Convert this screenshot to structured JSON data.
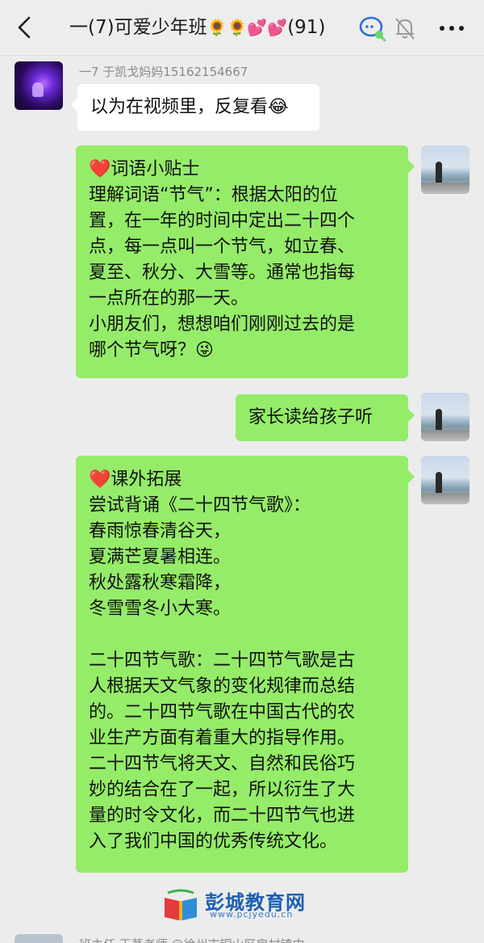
{
  "header": {
    "title_prefix": "一(7)可爱少年班",
    "title_emojis": "🌻🌻💕💕",
    "member_count": "(91)",
    "back_icon": "chevron-left-icon",
    "mention_icon": "chat-search-icon",
    "mute_icon": "bell-off-icon",
    "more_icon": "more-dots-icon"
  },
  "messages": [
    {
      "side": "left",
      "sender": "一7  于凯戈妈妈15162154667",
      "lines": [
        "以为在视频里，反复看😂"
      ]
    },
    {
      "side": "right",
      "lines": [
        "❤️词语小贴士",
        "理解词语“节气”：根据太阳的位",
        "置，在一年的时间中定出二十四个",
        "点，每一点叫一个节气，如立春、",
        "夏至、秋分、大雪等。通常也指每",
        "一点所在的那一天。",
        "小朋友们，想想咱们刚刚过去的是",
        "哪个节气呀？😜"
      ]
    },
    {
      "side": "right",
      "lines": [
        "家长读给孩子听"
      ]
    },
    {
      "side": "right",
      "lines": [
        "❤️课外拓展",
        "尝试背诵《二十四节气歌》：",
        "春雨惊春清谷天，",
        "夏满芒夏暑相连。",
        "秋处露秋寒霜降，",
        "冬雪雪冬小大寒。",
        "",
        "二十四节气歌：二十四节气歌是古",
        "人根据天文气象的变化规律而总结",
        "的。二十四节气歌在中国古代的农",
        "业生产方面有着重大的指导作用。",
        "二十四节气将天文、自然和民俗巧",
        "妙的结合在了一起，所以衍生了大",
        "量的时令文化，而二十四节气也进",
        "入了我们中国的优秀传统文化。"
      ]
    }
  ],
  "watermark": {
    "name": "彭城教育网",
    "url": "www.pcjyedu.cn"
  },
  "bottom_partial_sender": "班主任  王茅老师 @徐州市铜山区房村镇中"
}
